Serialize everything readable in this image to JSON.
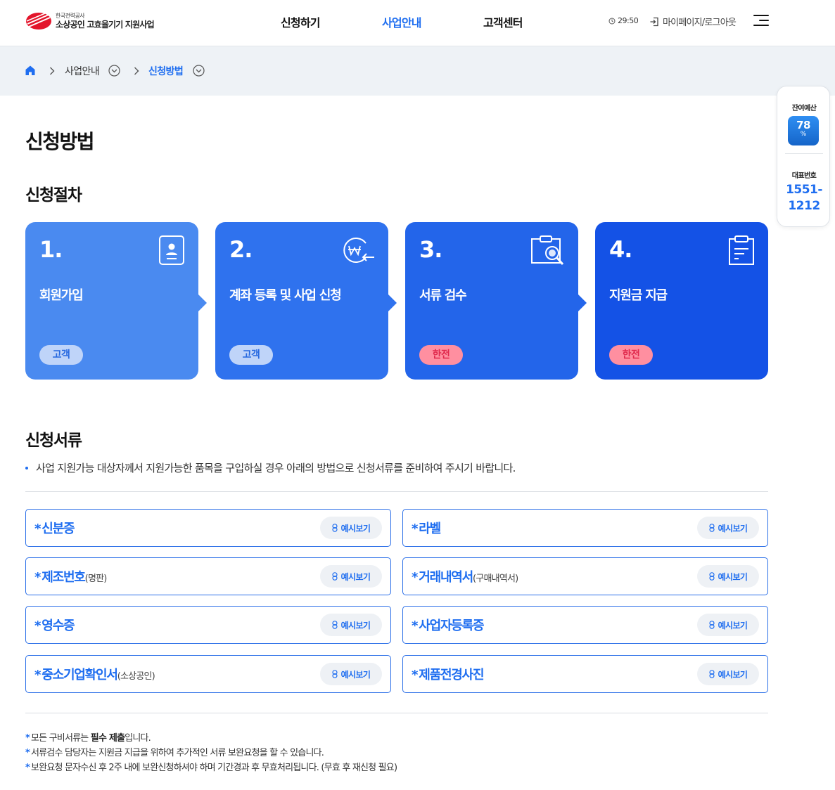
{
  "header": {
    "logo_top": "한국전력공사",
    "logo_bottom": "소상공인 고효율기기 지원사업",
    "nav": [
      {
        "label": "신청하기",
        "active": false
      },
      {
        "label": "사업안내",
        "active": true
      },
      {
        "label": "고객센터",
        "active": false
      }
    ],
    "timer": "29:50",
    "mypage_logout": "마이페이지/로그아웃"
  },
  "breadcrumb": {
    "items": [
      "사업안내",
      "신청방법"
    ]
  },
  "side_panel": {
    "budget_label": "잔여예산",
    "budget_value": "78",
    "budget_unit": "%",
    "phone_label": "대표번호",
    "phone_line1": "1551-",
    "phone_line2": "1212"
  },
  "page_title": "신청방법",
  "procedure": {
    "title": "신청절차",
    "steps": [
      {
        "num": "1.",
        "title": "회원가입",
        "badge": "고객",
        "icon": "member-card-icon",
        "color": "#4a8af0"
      },
      {
        "num": "2.",
        "title": "계좌 등록 및 사업 신청",
        "badge": "고객",
        "icon": "won-transfer-icon",
        "color": "#2f72ee"
      },
      {
        "num": "3.",
        "title": "서류 검수",
        "badge": "한전",
        "icon": "clipboard-search-icon",
        "color": "#2365ea"
      },
      {
        "num": "4.",
        "title": "지원금 지급",
        "badge": "한전",
        "icon": "clipboard-doc-icon",
        "color": "#1452e6"
      }
    ]
  },
  "documents": {
    "title": "신청서류",
    "description": "사업 지원가능 대상자께서 지원가능한 품목을 구입하실 경우 아래의 방법으로 신청서류를 준비하여 주시기 바랍니다.",
    "star": "*",
    "example_button": "예시보기",
    "items": [
      {
        "name": "신분증",
        "sub": ""
      },
      {
        "name": "라벨",
        "sub": ""
      },
      {
        "name": "제조번호",
        "sub": "(명판)"
      },
      {
        "name": "거래내역서",
        "sub": "(구매내역서)"
      },
      {
        "name": "영수증",
        "sub": ""
      },
      {
        "name": "사업자등록증",
        "sub": ""
      },
      {
        "name": "중소기업확인서",
        "sub": "(소상공인)"
      },
      {
        "name": "제품전경사진",
        "sub": ""
      }
    ]
  },
  "notes": {
    "star": "*",
    "note1_pre": "모든 구비서류는 ",
    "note1_bold": "필수 제출",
    "note1_post": "입니다.",
    "note2": "서류검수 담당자는 지원금 지급을 위하여 추가적인 서류 보완요청을 할 수 있습니다.",
    "note3": "보완요청 문자수신 후 2주 내에 보완신청하셔야 하며 기간경과 후 무효처리됩니다. (무효 후 재신청 필요)"
  }
}
